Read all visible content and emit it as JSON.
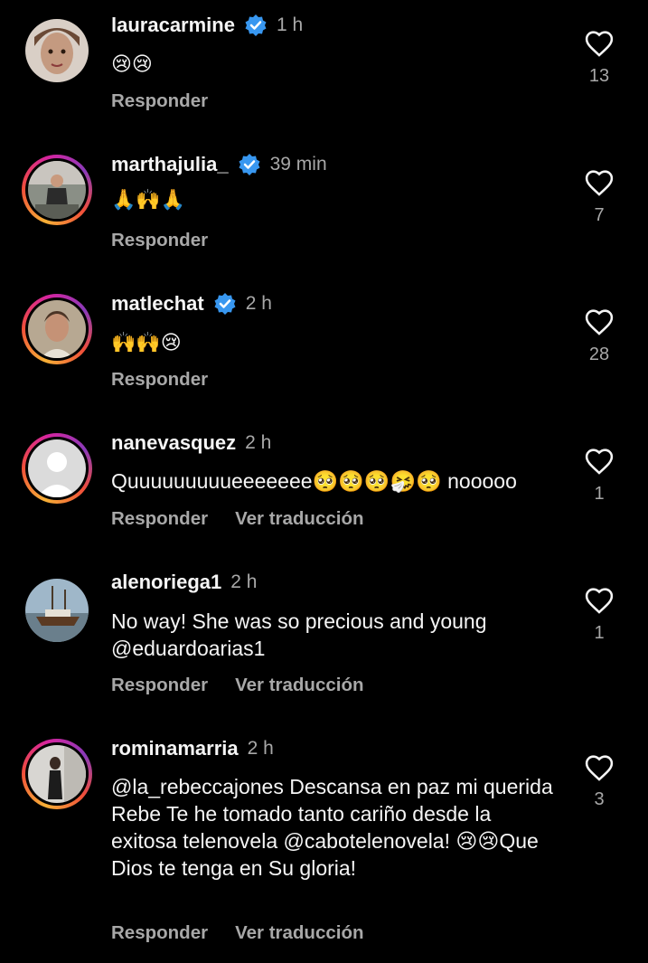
{
  "comments": [
    {
      "username": "lauracarmine",
      "verified": true,
      "time": "1 h",
      "text": "😢😢",
      "reply_label": "Responder",
      "translate_label": "",
      "likes": "13",
      "avatar_style": "plain"
    },
    {
      "username": "marthajulia_",
      "verified": true,
      "time": "39 min",
      "text": "🙏🙌🙏",
      "reply_label": "Responder",
      "translate_label": "",
      "likes": "7",
      "avatar_style": "ring"
    },
    {
      "username": "matlechat",
      "verified": true,
      "time": "2 h",
      "text": "🙌🙌😢",
      "reply_label": "Responder",
      "translate_label": "",
      "likes": "28",
      "avatar_style": "ring"
    },
    {
      "username": "nanevasquez",
      "verified": false,
      "time": "2 h",
      "text": "Quuuuuuuuueeeeeee🥺🥺🥺🤧🥺 nooooo",
      "reply_label": "Responder",
      "translate_label": "Ver traducción",
      "likes": "1",
      "avatar_style": "ring"
    },
    {
      "username": "alenoriega1",
      "verified": false,
      "time": "2 h",
      "text": "No way! She was so precious and young @eduardoarias1",
      "reply_label": "Responder",
      "translate_label": "Ver traducción",
      "likes": "1",
      "avatar_style": "plain"
    },
    {
      "username": "rominamarria",
      "verified": false,
      "time": "2 h",
      "text": "@la_rebeccajones  Descansa en paz mi querida Rebe Te he tomado tanto cariño desde la exitosa telenovela @cabotelenovela! 😢😢Que Dios te tenga en Su gloria!",
      "reply_label": "Responder",
      "translate_label": "Ver traducción",
      "likes": "3",
      "avatar_style": "ring"
    }
  ],
  "colors": {
    "background": "#000000",
    "text": "#f5f5f5",
    "muted": "#a8a8a8",
    "verified": "#3897f0"
  },
  "icons": {
    "verified": "verified-badge-icon",
    "like": "heart-outline-icon"
  }
}
